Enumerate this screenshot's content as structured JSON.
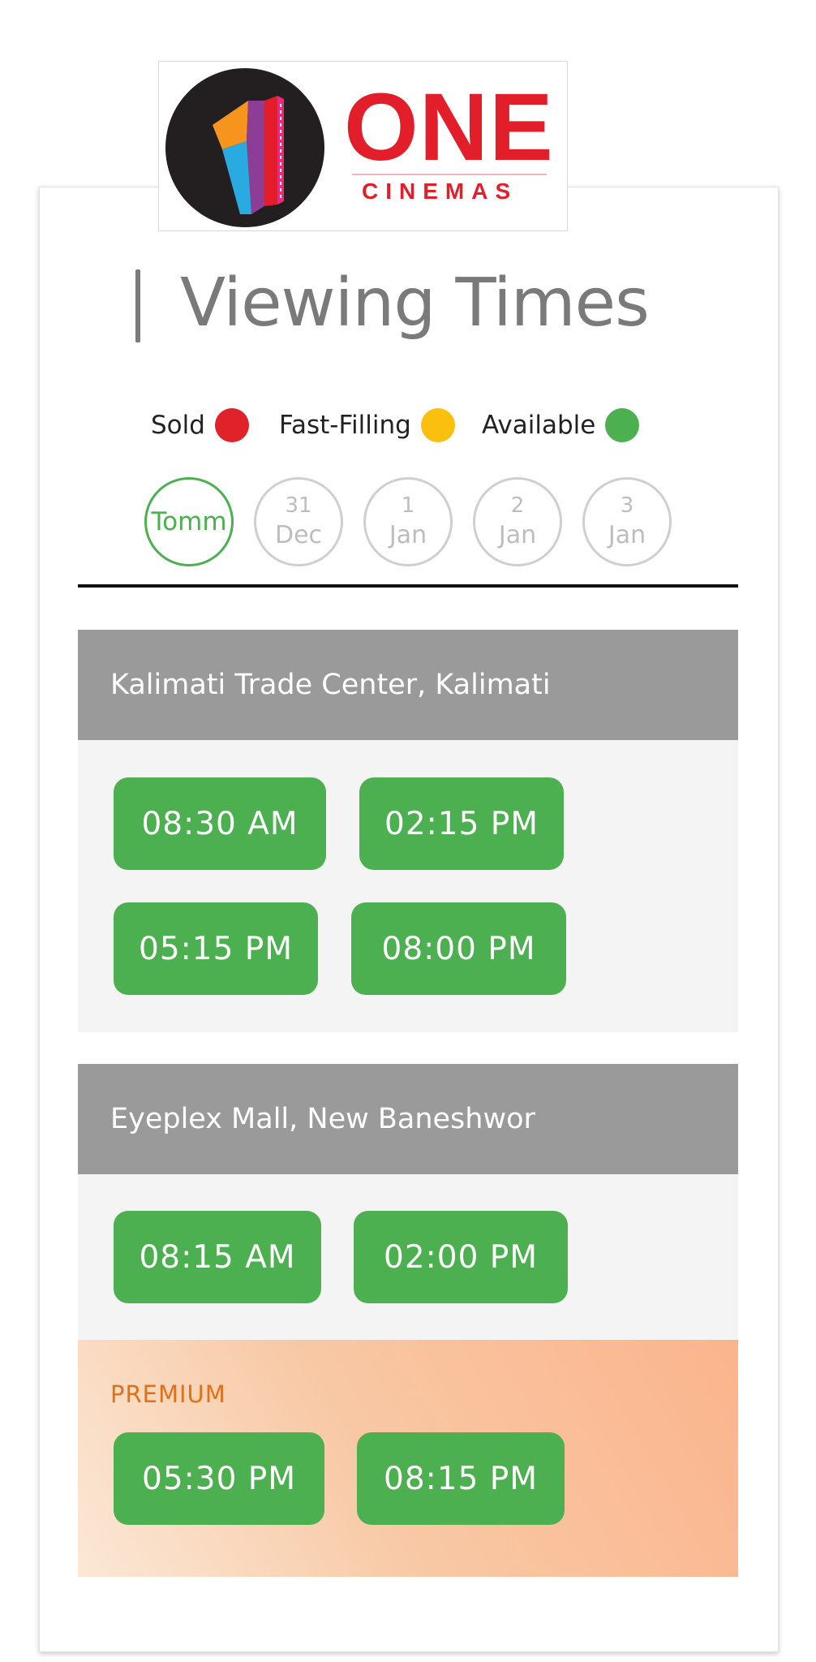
{
  "logo": {
    "brand": "ONE",
    "sub": "CINEMAS"
  },
  "title": "Viewing Times",
  "legend": [
    {
      "label": "Sold",
      "color": "#e0222a"
    },
    {
      "label": "Fast-Filling",
      "color": "#fbbf0f"
    },
    {
      "label": "Available",
      "color": "#4caf50"
    }
  ],
  "dates": [
    {
      "day": "",
      "label": "Tomm",
      "active": true
    },
    {
      "day": "31",
      "label": "Dec",
      "active": false
    },
    {
      "day": "1",
      "label": "Jan",
      "active": false
    },
    {
      "day": "2",
      "label": "Jan",
      "active": false
    },
    {
      "day": "3",
      "label": "Jan",
      "active": false
    }
  ],
  "venues": [
    {
      "name": "Kalimati Trade Center, Kalimati",
      "times": [
        "08:30 AM",
        "02:15 PM",
        "05:15 PM",
        "08:00 PM"
      ]
    },
    {
      "name": "Eyeplex Mall, New Baneshwor",
      "times": [
        "08:15 AM",
        "02:00 PM"
      ],
      "premium": {
        "label": "PREMIUM",
        "times": [
          "05:30 PM",
          "08:15 PM"
        ]
      }
    }
  ]
}
